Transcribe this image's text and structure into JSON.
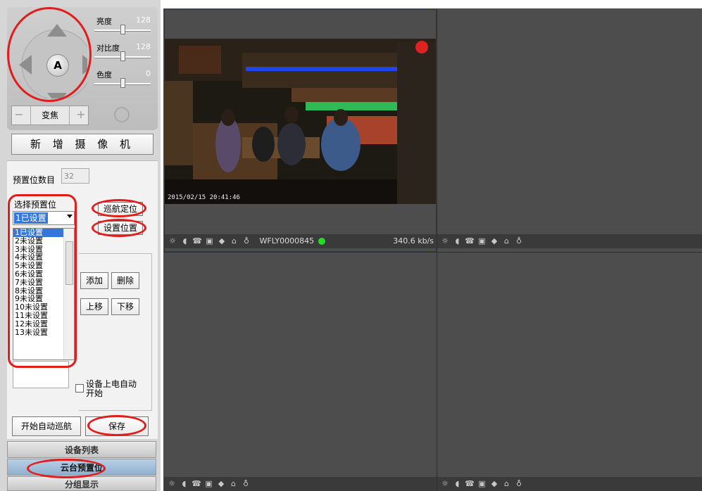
{
  "ptz": {
    "center_label": "A",
    "brightness": {
      "label": "亮度",
      "value": "128",
      "level": 0.5
    },
    "contrast": {
      "label": "对比度",
      "value": "128",
      "level": 0.5
    },
    "hue": {
      "label": "色度",
      "value": "0",
      "level": 0.5
    },
    "zoom": {
      "minus": "−",
      "label": "变焦",
      "plus": "+"
    }
  },
  "new_camera_label": "新 增 摄 像 机",
  "preset": {
    "count_label": "预置位数目",
    "count_value": "32",
    "select_label": "选择预置位",
    "selected_value": "1已设置",
    "patrol_button": "巡航定位",
    "set_button": "设置位置",
    "list": [
      "1已设置",
      "2未设置",
      "3未设置",
      "4未设置",
      "5未设置",
      "6未设置",
      "7未设置",
      "8未设置",
      "9未设置",
      "10未设置",
      "11未设置",
      "12未设置",
      "13未设置"
    ],
    "add_button": "添加",
    "delete_button": "删除",
    "up_button": "上移",
    "down_button": "下移",
    "auto_start_label_1": "设备上电自动",
    "auto_start_label_2": "开始",
    "start_patrol_button": "开始自动巡航",
    "save_button": "保存"
  },
  "tabs": {
    "device_list": "设备列表",
    "ptz_preset": "云台预置位",
    "group_display": "分组显示"
  },
  "video": {
    "timestamp": "2015/02/15 20:41:46",
    "device_id": "WFLY0000845",
    "bitrate": "340.6 kb/s",
    "status_color": "#22dd22"
  },
  "colors": {
    "annotation": "#e21b1b",
    "selection": "#3377dd"
  }
}
